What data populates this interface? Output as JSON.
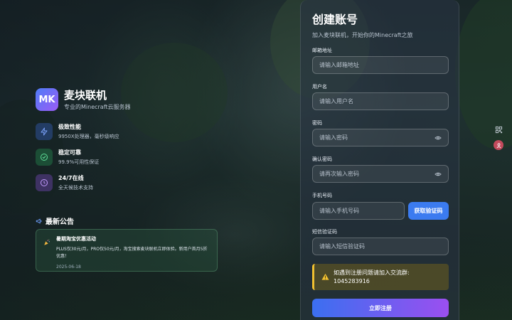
{
  "brand": {
    "logo_text": "MK",
    "title": "麦块联机",
    "subtitle": "专业的Minecraft云服务器"
  },
  "features": [
    {
      "icon": "lightning-icon",
      "title": "极致性能",
      "desc": "9950X处理器，毫秒级响应",
      "color": "#5b8df7"
    },
    {
      "icon": "shield-check-icon",
      "title": "稳定可靠",
      "desc": "99.9%可用性保证",
      "color": "#3ccf7a"
    },
    {
      "icon": "clock-icon",
      "title": "24/7在线",
      "desc": "全天候技术支持",
      "color": "#b07cf7"
    }
  ],
  "announcements": {
    "heading": "最新公告",
    "items": [
      {
        "title": "暑期淘宝优惠活动",
        "content": "PLUS仅30元/月，PRO仅50元/月，淘宝搜索麦块联机立即体验。新用户首月5折优惠！",
        "date": "2025-06-18"
      }
    ]
  },
  "register": {
    "title": "创建账号",
    "subtitle": "加入麦块联机，开始你的Minecraft之旅",
    "fields": {
      "email": {
        "label": "邮箱地址",
        "placeholder": "请输入邮箱地址"
      },
      "username": {
        "label": "用户名",
        "placeholder": "请输入用户名"
      },
      "password": {
        "label": "密码",
        "placeholder": "请输入密码"
      },
      "confirm": {
        "label": "确认密码",
        "placeholder": "请再次输入密码"
      },
      "phone": {
        "label": "手机号码",
        "placeholder": "请输入手机号码"
      },
      "sms": {
        "label": "短信验证码",
        "placeholder": "请输入短信验证码"
      }
    },
    "get_code_label": "获取验证码",
    "notice_line1": "如遇到注册问题请加入交流群:",
    "notice_line2": "1045283916",
    "submit_label": "立即注册"
  },
  "colors": {
    "accent": "#3b7bf0",
    "submit_gradient_start": "#3b6ff0",
    "submit_gradient_end": "#9b4ff0",
    "warning": "#f0c030"
  }
}
